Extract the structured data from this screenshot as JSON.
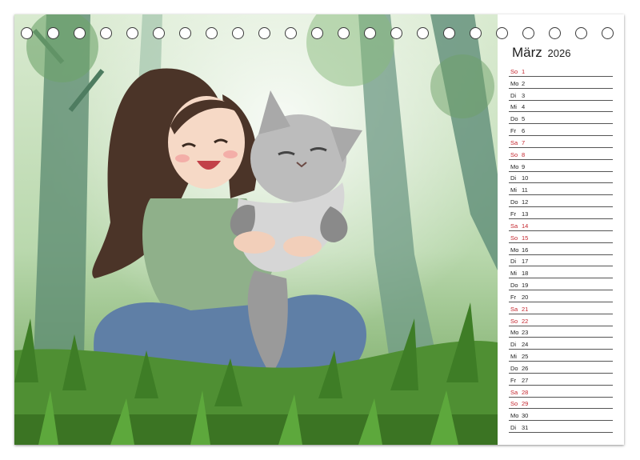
{
  "month": {
    "name": "März",
    "year": "2026"
  },
  "days": [
    {
      "wd": "So",
      "d": "1",
      "weekend": true
    },
    {
      "wd": "Mo",
      "d": "2",
      "weekend": false
    },
    {
      "wd": "Di",
      "d": "3",
      "weekend": false
    },
    {
      "wd": "Mi",
      "d": "4",
      "weekend": false
    },
    {
      "wd": "Do",
      "d": "5",
      "weekend": false
    },
    {
      "wd": "Fr",
      "d": "6",
      "weekend": false
    },
    {
      "wd": "Sa",
      "d": "7",
      "weekend": true
    },
    {
      "wd": "So",
      "d": "8",
      "weekend": true
    },
    {
      "wd": "Mo",
      "d": "9",
      "weekend": false
    },
    {
      "wd": "Di",
      "d": "10",
      "weekend": false
    },
    {
      "wd": "Mi",
      "d": "11",
      "weekend": false
    },
    {
      "wd": "Do",
      "d": "12",
      "weekend": false
    },
    {
      "wd": "Fr",
      "d": "13",
      "weekend": false
    },
    {
      "wd": "Sa",
      "d": "14",
      "weekend": true
    },
    {
      "wd": "So",
      "d": "15",
      "weekend": true
    },
    {
      "wd": "Mo",
      "d": "16",
      "weekend": false
    },
    {
      "wd": "Di",
      "d": "17",
      "weekend": false
    },
    {
      "wd": "Mi",
      "d": "18",
      "weekend": false
    },
    {
      "wd": "Do",
      "d": "19",
      "weekend": false
    },
    {
      "wd": "Fr",
      "d": "20",
      "weekend": false
    },
    {
      "wd": "Sa",
      "d": "21",
      "weekend": true
    },
    {
      "wd": "So",
      "d": "22",
      "weekend": true
    },
    {
      "wd": "Mo",
      "d": "23",
      "weekend": false
    },
    {
      "wd": "Di",
      "d": "24",
      "weekend": false
    },
    {
      "wd": "Mi",
      "d": "25",
      "weekend": false
    },
    {
      "wd": "Do",
      "d": "26",
      "weekend": false
    },
    {
      "wd": "Fr",
      "d": "27",
      "weekend": false
    },
    {
      "wd": "Sa",
      "d": "28",
      "weekend": true
    },
    {
      "wd": "So",
      "d": "29",
      "weekend": true
    },
    {
      "wd": "Mo",
      "d": "30",
      "weekend": false
    },
    {
      "wd": "Di",
      "d": "31",
      "weekend": false
    }
  ],
  "colors": {
    "weekend": "#c4262e",
    "text": "#222222",
    "rule": "#555555"
  }
}
